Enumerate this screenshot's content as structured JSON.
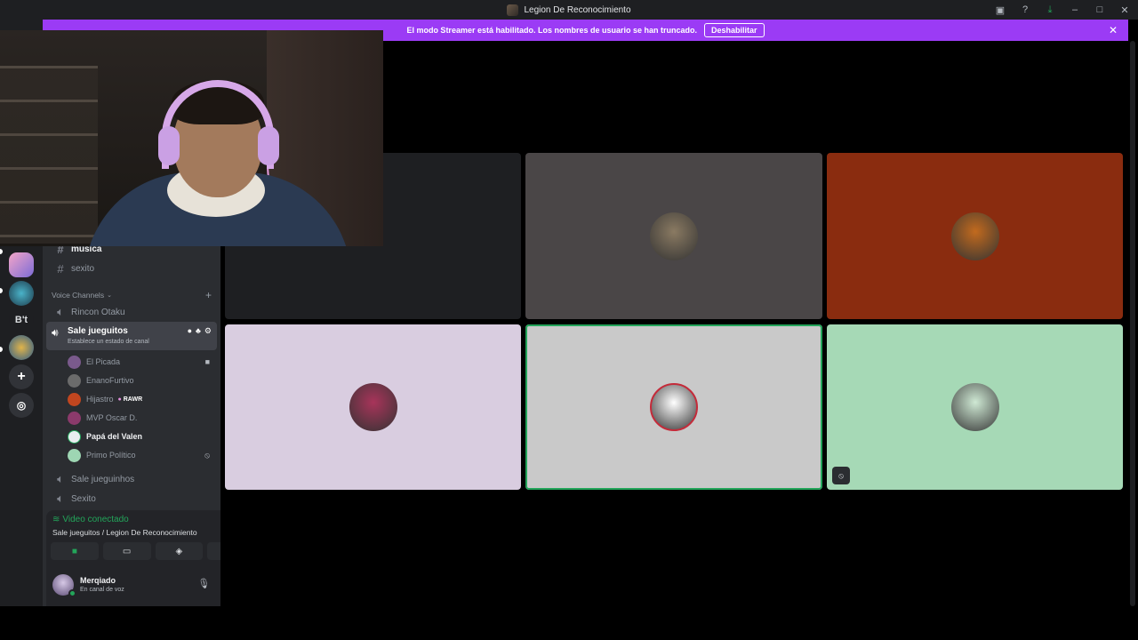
{
  "window": {
    "title": "Legion De Reconocimiento"
  },
  "banner": {
    "message": "El modo Streamer está habilitado. Los nombres de usuario se han truncado.",
    "button": "Deshabilitar"
  },
  "server_rail": {
    "items": [
      "B't"
    ]
  },
  "sidebar": {
    "text_channels": [
      {
        "name": "musica",
        "unread": true
      },
      {
        "name": "sexito",
        "unread": false
      }
    ],
    "voice_section_label": "Voice Channels",
    "voice_channels": [
      {
        "name": "Rincon Otaku"
      },
      {
        "name": "Sale jueguitos",
        "status": "Establece un estado de canal",
        "active": true
      },
      {
        "name": "Sale jueguinhos"
      },
      {
        "name": "Sexito"
      }
    ],
    "voice_users": [
      {
        "name": "El Picada",
        "avatar_color": "#7a5a8c",
        "icon": "video-icon"
      },
      {
        "name": "EnanoFurtivo",
        "avatar_color": "#6b6b6b"
      },
      {
        "name": "Hijastro",
        "avatar_color": "#c1461f",
        "badge": "RAWR"
      },
      {
        "name": "MVP Oscar D.",
        "avatar_color": "#8b3a6b"
      },
      {
        "name": "Papá del Valen",
        "avatar_color": "#e9eef0",
        "bold": true
      },
      {
        "name": "Primo Político",
        "avatar_color": "#9ed6b3",
        "icon": "mic-muted-icon"
      }
    ]
  },
  "voice_panel": {
    "status": "Video conectado",
    "channel": "Sale jueguitos / Legion De Reconocimiento",
    "buttons": [
      "camera-icon",
      "screen-share-icon",
      "activity-icon",
      "soundboard-icon"
    ]
  },
  "user_panel": {
    "name": "Merqiado",
    "status": "En canal de voz"
  },
  "tiles": [
    {
      "bg": "#1e1f22",
      "avatar": null
    },
    {
      "bg": "#4a4647",
      "avatar": "#8a7a62"
    },
    {
      "bg": "#8a2c0f",
      "avatar": "#c26a1e"
    },
    {
      "bg": "#d9cde0",
      "avatar": "#a8345a"
    },
    {
      "bg": "#c9c9c9",
      "avatar": "#ffffff",
      "speaking": true
    },
    {
      "bg": "#a6d9b6",
      "avatar": "#cfe9d4",
      "muted": true
    }
  ]
}
